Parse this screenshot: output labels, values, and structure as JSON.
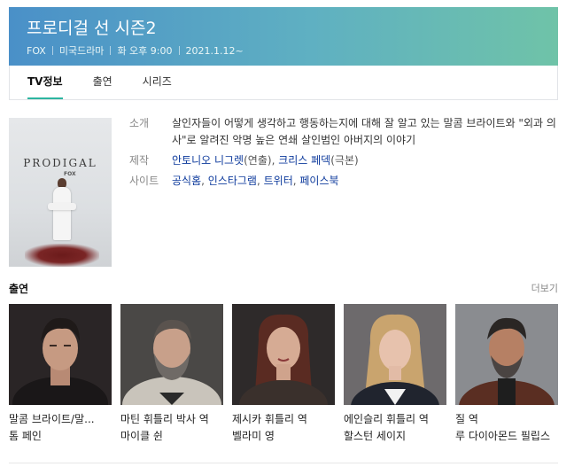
{
  "header": {
    "title": "프로디걸 선 시즌2",
    "meta": [
      "FOX",
      "미국드라마",
      "화 오후 9:00",
      "2021.1.12~"
    ]
  },
  "tabs": [
    {
      "label": "TV정보",
      "active": true
    },
    {
      "label": "출연",
      "active": false
    },
    {
      "label": "시리즈",
      "active": false
    }
  ],
  "poster": {
    "title": "PRODIGAL",
    "network_mark": "FOX"
  },
  "info": {
    "synopsis_label": "소개",
    "synopsis": "살인자들이 어떻게 생각하고 행동하는지에 대해 잘 알고 있는 말콤 브라이트와 \"외과 의사\"로 알려진 악명 높은 연쇄 살인범인 아버지의 이야기",
    "production_label": "제작",
    "production": [
      {
        "name": "안토니오 니그렛",
        "role": "(연출)"
      },
      {
        "name": "크리스 페덱",
        "role": "(극본)"
      }
    ],
    "production_sep": ", ",
    "site_label": "사이트",
    "sites": [
      "공식홈",
      "인스타그램",
      "트위터",
      "페이스북"
    ],
    "site_sep": ", "
  },
  "cast_section": {
    "title": "출연",
    "more": "더보기",
    "members": [
      {
        "role": "말콤 브라이트/말...",
        "actor": "톰 페인"
      },
      {
        "role": "마틴 휘틀리 박사 역",
        "actor": "마이클 쉰"
      },
      {
        "role": "제시카 휘틀리 역",
        "actor": "벨라미 영"
      },
      {
        "role": "에인슬리 휘틀리 역",
        "actor": "할스턴 세이지"
      },
      {
        "role": "질 역",
        "actor": "루 다이아몬드 필립스"
      }
    ]
  },
  "colors": {
    "header_gradient_start": "#4a90c8",
    "header_gradient_end": "#6fc3a8",
    "tab_active_underline": "#2db5a0",
    "link": "#0d3a9c"
  }
}
